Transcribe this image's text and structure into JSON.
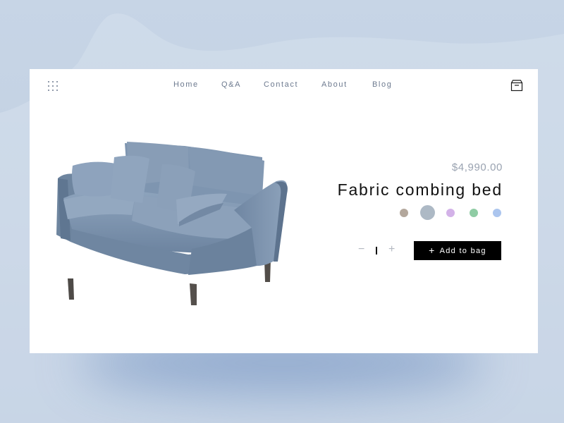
{
  "nav": {
    "items": [
      "Home",
      "Q&A",
      "Contact",
      "About",
      "Blog"
    ]
  },
  "icons": {
    "menu": "grid-menu-icon",
    "cart": "shopping-bag-icon",
    "add": "plus-icon"
  },
  "product": {
    "price": "$4,990.00",
    "title": "Fabric combing bed",
    "colors": [
      "#b3a79c",
      "#adb9c5",
      "#d3b2e8",
      "#8fcca4",
      "#abc5ee"
    ],
    "selected_color_index": 1,
    "quantity": "1",
    "qty_minus": "−",
    "qty_plus": "+",
    "add_label": "Add to bag",
    "add_icon": "+"
  }
}
